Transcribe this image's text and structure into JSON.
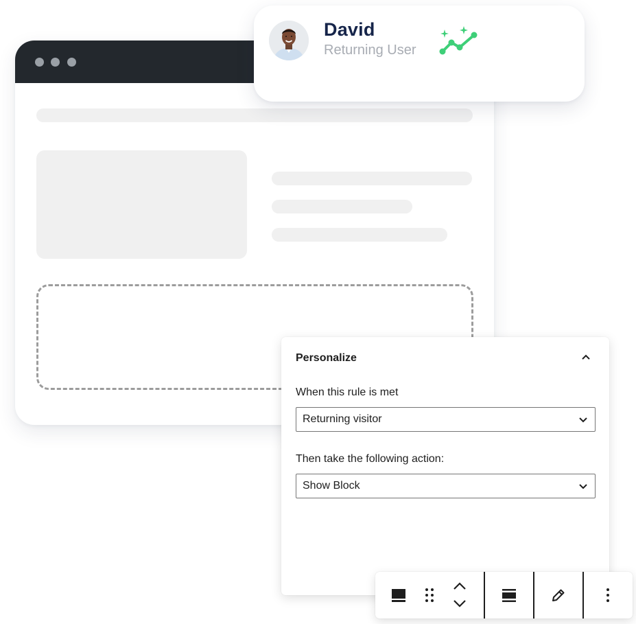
{
  "user_card": {
    "name": "David",
    "status": "Returning User",
    "icons": {
      "avatar": "user-avatar-photo",
      "trend": "sparkle-trend-up-icon"
    },
    "accent_color": "#3ecf78"
  },
  "browser_mockup": {
    "bar_color": "#23282d",
    "window_controls": [
      "dot",
      "dot",
      "dot"
    ]
  },
  "personalize_panel": {
    "title": "Personalize",
    "toggle_icon": "chevron-up-icon",
    "rule_label": "When this rule is met",
    "rule_value": "Returning visitor",
    "action_label": "Then take the following action:",
    "action_value": "Show Block",
    "select_icon": "chevron-down-icon"
  },
  "toolbar": {
    "buttons": [
      {
        "icon": "desktop-block-icon"
      },
      {
        "icon": "drag-handle-icon"
      },
      {
        "icon": "move-up-icon"
      },
      {
        "icon": "move-down-icon"
      },
      {
        "icon": "align-icon"
      },
      {
        "icon": "edit-pencil-icon"
      },
      {
        "icon": "more-options-icon"
      }
    ]
  },
  "colors": {
    "text_dark": "#1e1e1e",
    "name_navy": "#16254a",
    "muted_grey": "#a8acb3",
    "skeleton": "#f0f0f0",
    "dashed_border": "#9c9c9c"
  }
}
